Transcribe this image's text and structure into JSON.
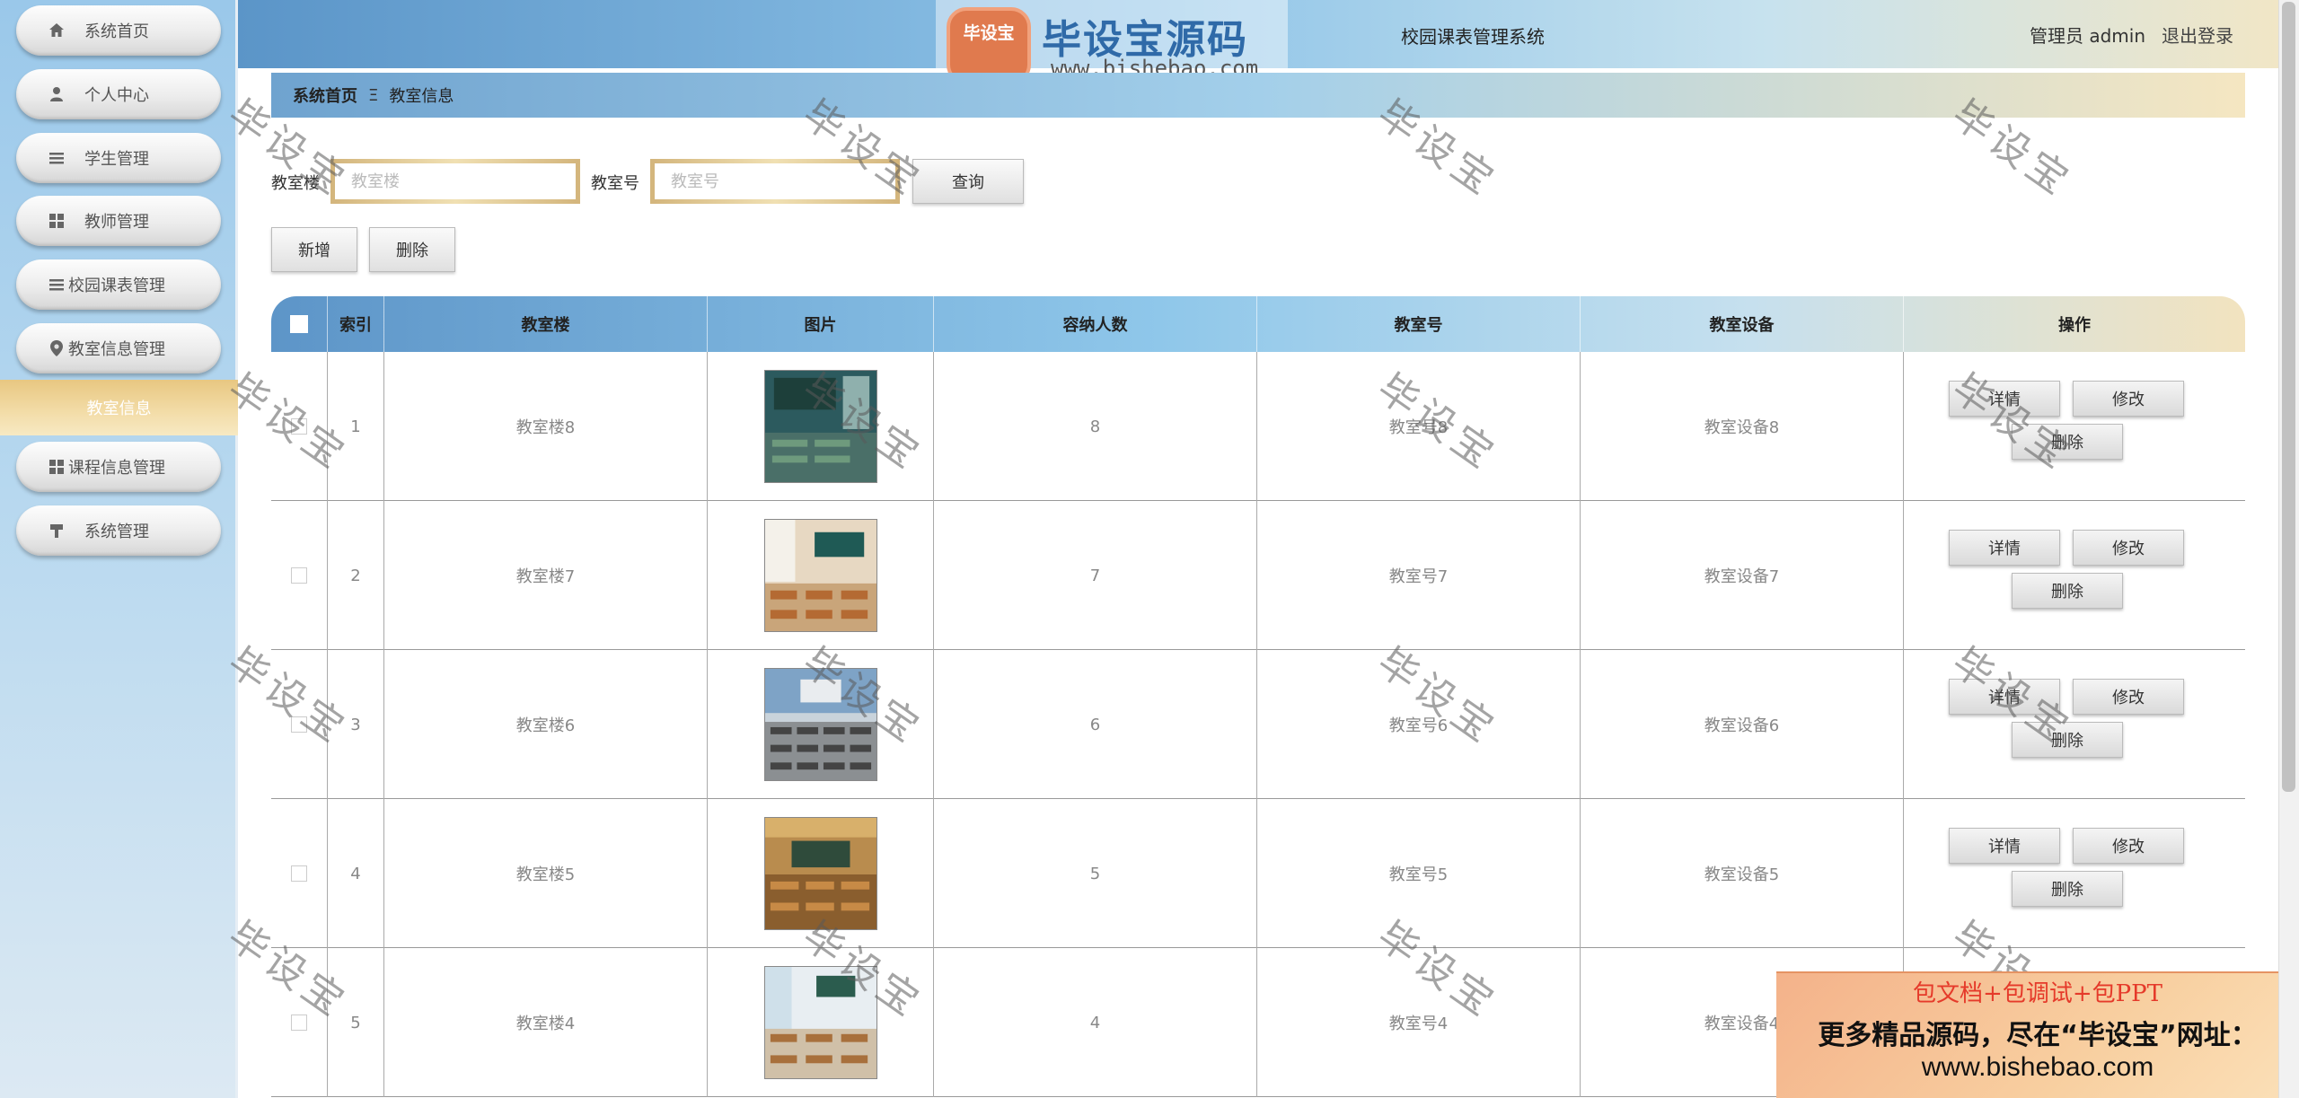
{
  "app": {
    "title": "校园课表管理系统",
    "user_label": "管理员 admin",
    "logout_label": "退出登录"
  },
  "sidebar": {
    "items": [
      {
        "label": "系统首页",
        "icon": "home-icon"
      },
      {
        "label": "个人中心",
        "icon": "user-icon"
      },
      {
        "label": "学生管理",
        "icon": "list-icon"
      },
      {
        "label": "教师管理",
        "icon": "grid-icon"
      },
      {
        "label": "校园课表管理",
        "icon": "list-icon"
      },
      {
        "label": "教室信息管理",
        "icon": "location-icon"
      },
      {
        "label": "课程信息管理",
        "icon": "grid-icon"
      },
      {
        "label": "系统管理",
        "icon": "settings-icon"
      }
    ],
    "active_sub": "教室信息"
  },
  "breadcrumb": {
    "home": "系统首页",
    "separator": "Ξ",
    "current": "教室信息"
  },
  "search": {
    "building_label": "教室楼",
    "building_placeholder": "教室楼",
    "room_label": "教室号",
    "room_placeholder": "教室号",
    "query_label": "查询"
  },
  "toolbar": {
    "add_label": "新增",
    "delete_label": "删除"
  },
  "table": {
    "headers": [
      "索引",
      "教室楼",
      "图片",
      "容纳人数",
      "教室号",
      "教室设备",
      "操作"
    ],
    "rows": [
      {
        "index": "1",
        "building": "教室楼8",
        "capacity": "8",
        "room": "教室号8",
        "equipment": "教室设备8"
      },
      {
        "index": "2",
        "building": "教室楼7",
        "capacity": "7",
        "room": "教室号7",
        "equipment": "教室设备7"
      },
      {
        "index": "3",
        "building": "教室楼6",
        "capacity": "6",
        "room": "教室号6",
        "equipment": "教室设备6"
      },
      {
        "index": "4",
        "building": "教室楼5",
        "capacity": "5",
        "room": "教室号5",
        "equipment": "教室设备5"
      },
      {
        "index": "5",
        "building": "教室楼4",
        "capacity": "4",
        "room": "教室号4",
        "equipment": "教室设备4"
      }
    ],
    "ops": {
      "detail": "详情",
      "edit": "修改",
      "delete": "删除"
    }
  },
  "watermark": {
    "logo_badge": "毕设宝",
    "logo_text": "毕设宝源码网",
    "logo_url": "www.bishebao.com",
    "diag_text": "毕设宝"
  },
  "promo": {
    "line1": "包文档+包调试+包PPT",
    "line2": "更多精品源码，尽在“毕设宝”网址：",
    "line3": "www.bishebao.com"
  }
}
